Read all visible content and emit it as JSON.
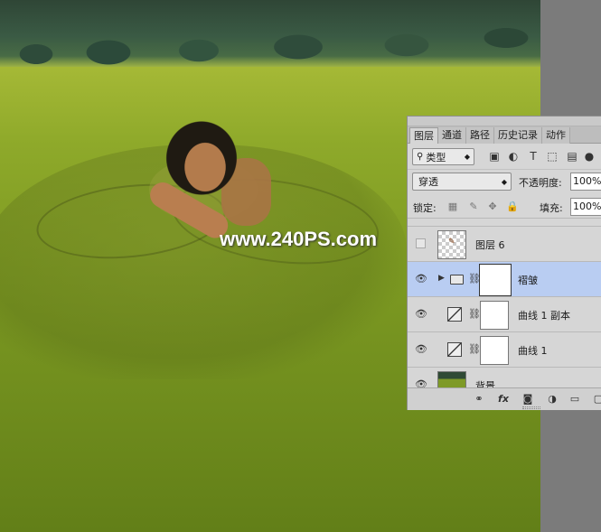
{
  "watermark": "www.240PS.com",
  "panel": {
    "tabs": [
      "图层",
      "通道",
      "路径",
      "历史记录",
      "动作"
    ],
    "active_tab": "图层",
    "filter": {
      "value": "类型",
      "search_icon": "🔍"
    },
    "filter_icons": [
      "image-filter-icon",
      "adjustment-filter-icon",
      "text-filter-icon",
      "shape-filter-icon",
      "smart-object-filter-icon"
    ],
    "blend_mode": "穿透",
    "opacity_label": "不透明度:",
    "opacity_value": "100%",
    "lock_label": "锁定:",
    "fill_label": "填充:",
    "fill_value": "100%",
    "layers": [
      {
        "name": "图层 6",
        "visible": false,
        "type": "pixel"
      },
      {
        "name": "褶皱",
        "visible": true,
        "type": "group",
        "selected": true
      },
      {
        "name": "曲线 1 副本",
        "visible": true,
        "type": "curves"
      },
      {
        "name": "曲线 1",
        "visible": true,
        "type": "curves"
      },
      {
        "name": "背景",
        "visible": true,
        "type": "background"
      }
    ],
    "bottom_icons": [
      "link-layers-icon",
      "fx-icon",
      "add-mask-icon",
      "adjustment-layer-icon",
      "new-group-icon",
      "new-layer-icon"
    ]
  }
}
